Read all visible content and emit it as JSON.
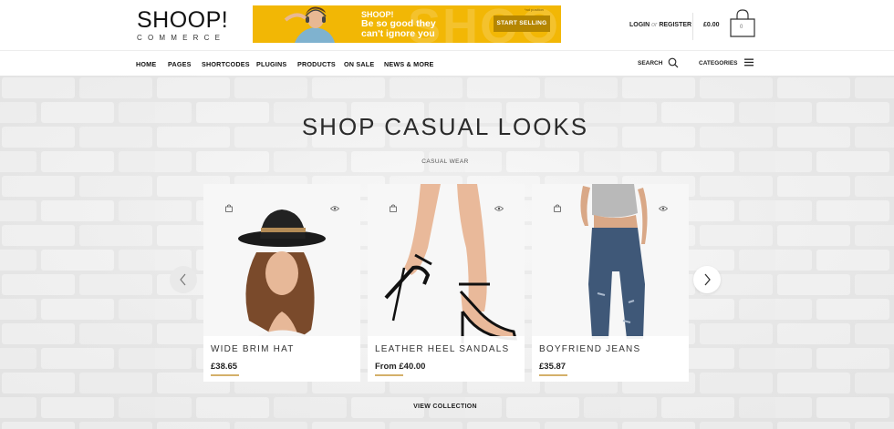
{
  "header": {
    "logo_main": "SHOOP!",
    "logo_sub": "COMMERCE",
    "banner": {
      "brand": "SHOOP!",
      "line1": "Be so good they",
      "line2": "can't ignore you",
      "button": "START SELLING",
      "ad_note": "*ad position",
      "ghost_text": "SHOOP!"
    },
    "login": "LOGIN",
    "login_sep": "or",
    "register": "REGISTER",
    "cart_total": "£0.00",
    "cart_count": "0"
  },
  "nav": {
    "items": [
      "HOME",
      "PAGES",
      "SHORTCODES",
      "PLUGINS",
      "PRODUCTS",
      "ON SALE",
      "NEWS & MORE"
    ],
    "search_label": "SEARCH",
    "categories_label": "CATEGORIES"
  },
  "hero": {
    "title": "SHOP CASUAL LOOKS",
    "subtitle": "CASUAL WEAR",
    "view_collection": "VIEW COLLECTION"
  },
  "products": [
    {
      "name": "WIDE BRIM HAT",
      "price": "£38.65"
    },
    {
      "name": "LEATHER HEEL SANDALS",
      "price": "From £40.00"
    },
    {
      "name": "BOYFRIEND JEANS",
      "price": "£35.87"
    }
  ],
  "colors": {
    "banner_yellow": "#f2b705",
    "price_underline": "#d4b06a",
    "hero_bg": "#ececec"
  },
  "icons": [
    "cart-bag-icon",
    "search-icon",
    "menu-icon",
    "bag-icon",
    "eye-icon",
    "chevron-left-icon",
    "chevron-right-icon"
  ]
}
